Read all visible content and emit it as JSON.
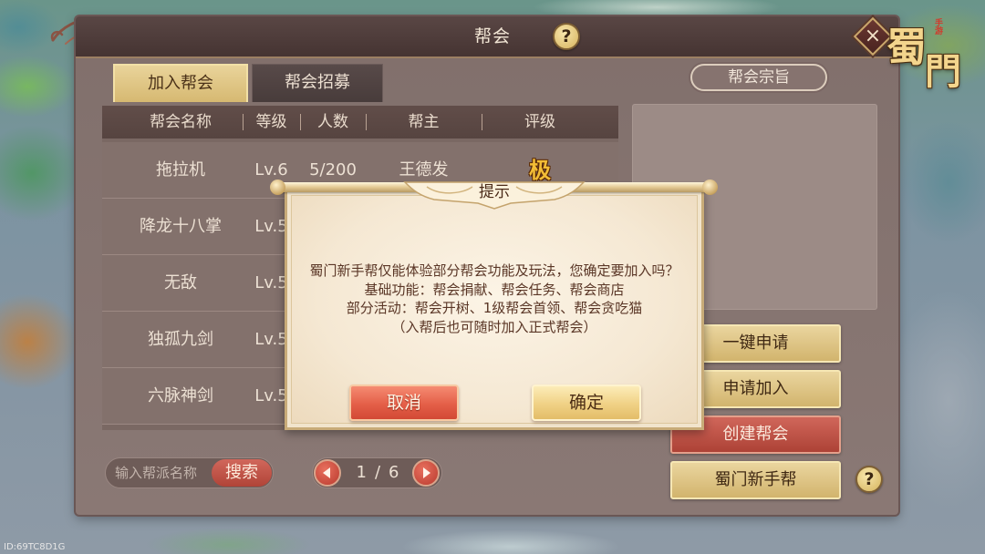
{
  "screen": {
    "title": "帮会"
  },
  "logo": {
    "top_char": "蜀",
    "bottom_char": "門",
    "seal": "手游"
  },
  "icons": {
    "help": "help-icon",
    "close": "close-icon",
    "prev": "arrow-left-icon",
    "next": "arrow-right-icon",
    "rating": "rating-badge-icon",
    "help_glyph": "?",
    "close_glyph": "×"
  },
  "tabs": [
    {
      "label": "加入帮会",
      "active": true
    },
    {
      "label": "帮会招募",
      "active": false
    }
  ],
  "guild_purpose": {
    "label": "帮会宗旨"
  },
  "guild_table": {
    "columns": [
      "帮会名称",
      "等级",
      "人数",
      "帮主",
      "评级"
    ],
    "rows": [
      {
        "name": "拖拉机",
        "level": "Lv.6",
        "members": "5/200",
        "leader": "王德发",
        "rating": "极"
      },
      {
        "name": "降龙十八掌",
        "level": "Lv.5"
      },
      {
        "name": "无敌",
        "level": "Lv.5"
      },
      {
        "name": "独孤九剑",
        "level": "Lv.5"
      },
      {
        "name": "六脉神剑",
        "level": "Lv.5"
      }
    ]
  },
  "actions": {
    "quick_apply": "一键申请",
    "apply_join": "申请加入",
    "create_guild": "创建帮会",
    "newbie_guild": "蜀门新手帮"
  },
  "search": {
    "placeholder": "输入帮派名称",
    "value": "",
    "button": "搜索"
  },
  "pagination": {
    "current": 1,
    "separator": "/",
    "total": 6
  },
  "dialog": {
    "title": "提示",
    "lines": [
      "蜀门新手帮仅能体验部分帮会功能及玩法，您确定要加入吗？",
      "基础功能：帮会捐献、帮会任务、帮会商店",
      "部分活动：帮会开树、1级帮会首领、帮会贪吃猫",
      "（入帮后也可随时加入正式帮会）"
    ],
    "cancel": "取消",
    "confirm": "确定"
  },
  "build_id": "ID:69TC8D1G",
  "colors": {
    "panel": "#867470",
    "titlebar": "#4f3b39",
    "accent_gold": "#e3c77e",
    "accent_red": "#c94d3f",
    "dialog_bg": "#f5e8d3",
    "dialog_text": "#5a3626",
    "table_text": "#ece0d3"
  }
}
